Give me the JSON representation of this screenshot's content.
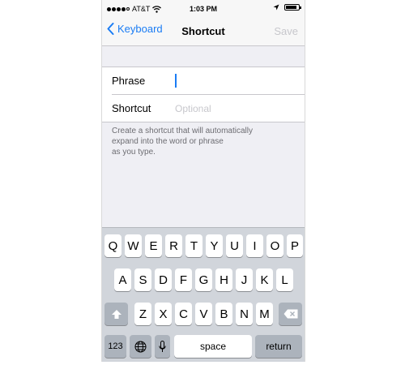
{
  "status_bar": {
    "carrier": "AT&T",
    "time": "1:03 PM"
  },
  "nav": {
    "back_label": "Keyboard",
    "title": "Shortcut",
    "save_label": "Save"
  },
  "form": {
    "phrase_label": "Phrase",
    "phrase_value": "",
    "shortcut_label": "Shortcut",
    "shortcut_placeholder": "Optional"
  },
  "note": "Create a shortcut that will automatically\n expand into the word or phrase\n as you type.",
  "keyboard": {
    "row1": [
      "Q",
      "W",
      "E",
      "R",
      "T",
      "Y",
      "U",
      "I",
      "O",
      "P"
    ],
    "row2": [
      "A",
      "S",
      "D",
      "F",
      "G",
      "H",
      "J",
      "K",
      "L"
    ],
    "row3": [
      "Z",
      "X",
      "C",
      "V",
      "B",
      "N",
      "M"
    ],
    "numbers_label": "123",
    "space_label": "space",
    "return_label": "return",
    "icons": [
      "shift-icon",
      "delete-icon",
      "globe-icon",
      "microphone-icon"
    ]
  },
  "colors": {
    "accent": "#1a7cf4",
    "disabled": "#c7c7cc",
    "background": "#efeff4",
    "keyboard_bg": "#d1d5db"
  }
}
